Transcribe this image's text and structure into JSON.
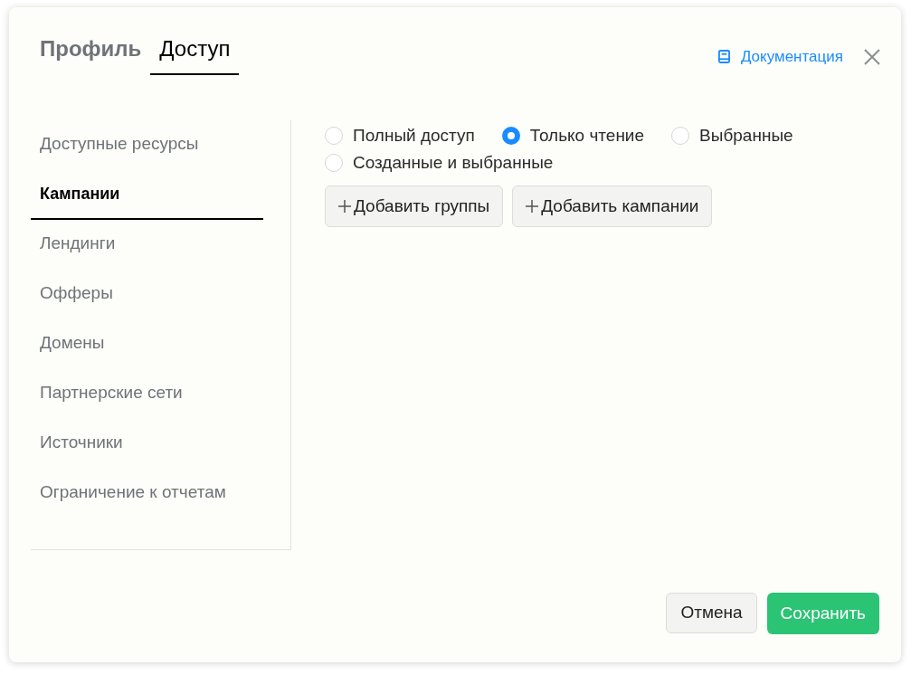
{
  "tabs": [
    {
      "label": "Профиль",
      "selected": false
    },
    {
      "label": "Доступ",
      "selected": true
    }
  ],
  "documentation_link": "Документация",
  "sidebar": {
    "items": [
      {
        "label": "Доступные ресурсы",
        "selected": false
      },
      {
        "label": "Кампании",
        "selected": true
      },
      {
        "label": "Лендинги",
        "selected": false
      },
      {
        "label": "Офферы",
        "selected": false
      },
      {
        "label": "Домены",
        "selected": false
      },
      {
        "label": "Партнерские сети",
        "selected": false
      },
      {
        "label": "Источники",
        "selected": false
      },
      {
        "label": "Ограничение к отчетам",
        "selected": false
      }
    ]
  },
  "access_options": [
    {
      "label": "Полный доступ",
      "selected": false
    },
    {
      "label": "Только чтение",
      "selected": true
    },
    {
      "label": "Выбранные",
      "selected": false
    },
    {
      "label": "Созданные и выбранные",
      "selected": false
    }
  ],
  "add_buttons": [
    "Добавить группы",
    "Добавить кампании"
  ],
  "footer": {
    "cancel": "Отмена",
    "save": "Сохранить"
  }
}
